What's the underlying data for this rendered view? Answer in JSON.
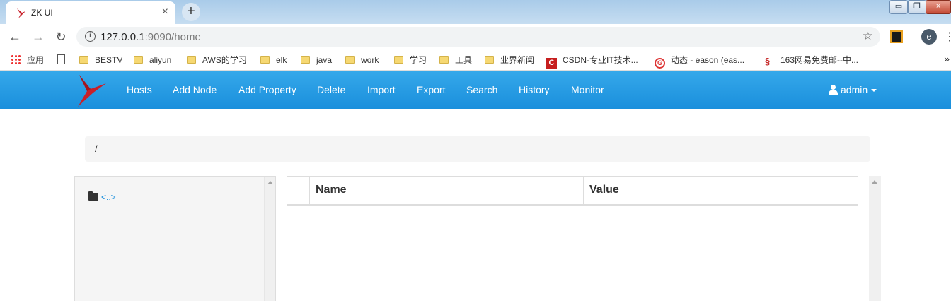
{
  "browser": {
    "tab_title": "ZK UI",
    "tab_close": "×",
    "new_tab": "+",
    "url_host": "127.0.0.1",
    "url_rest": ":9090/home",
    "profile_initial": "e",
    "window_min": "▭",
    "window_max": "❐",
    "window_close": "×",
    "icons": [
      "back-arrow-icon",
      "forward-arrow-icon",
      "reload-icon",
      "info-icon",
      "star-icon"
    ]
  },
  "bookmarks": {
    "apps": "应用",
    "items": [
      "BESTV",
      "aliyun",
      "AWS的学习",
      "elk",
      "java",
      "work",
      "学习",
      "工具",
      "业界新闻"
    ],
    "csdn": "CSDN-专业IT技术...",
    "dynamic": "动态 - eason (eas...",
    "mail163": "163网易免费邮--中...",
    "more": "»"
  },
  "navbar": {
    "links": [
      "Hosts",
      "Add Node",
      "Add Property",
      "Delete",
      "Import",
      "Export",
      "Search",
      "History",
      "Monitor"
    ],
    "user": "admin",
    "brand_color": "#c8202a",
    "bar_color": "#1a8fdc"
  },
  "breadcrumb": {
    "path": "/"
  },
  "tree": {
    "parent_link": "<..>"
  },
  "table": {
    "col_name": "Name",
    "col_value": "Value"
  }
}
